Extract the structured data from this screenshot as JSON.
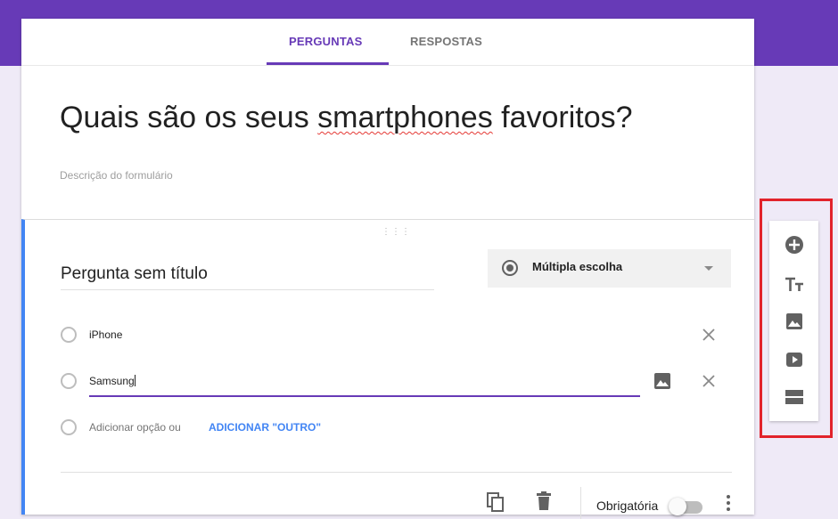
{
  "tabs": {
    "questions": "PERGUNTAS",
    "responses": "RESPOSTAS"
  },
  "form": {
    "title_pre": "Quais são os seus ",
    "title_misspelled": "smartphones",
    "title_post": " favoritos?",
    "description_placeholder": "Descrição do formulário"
  },
  "question": {
    "title": "Pergunta sem título",
    "type": "Múltipla escolha",
    "options": [
      "iPhone",
      "Samsung"
    ],
    "add_option": "Adicionar opção",
    "or": "ou",
    "add_other": "ADICIONAR \"OUTRO\"",
    "required_label": "Obrigatória",
    "required": false
  },
  "sidebar_tools": [
    "add-question-icon",
    "title-text-icon",
    "image-icon",
    "video-icon",
    "section-icon"
  ],
  "colors": {
    "accent": "#673ab7",
    "active_border": "#4285f4",
    "highlight": "#e2232b"
  }
}
